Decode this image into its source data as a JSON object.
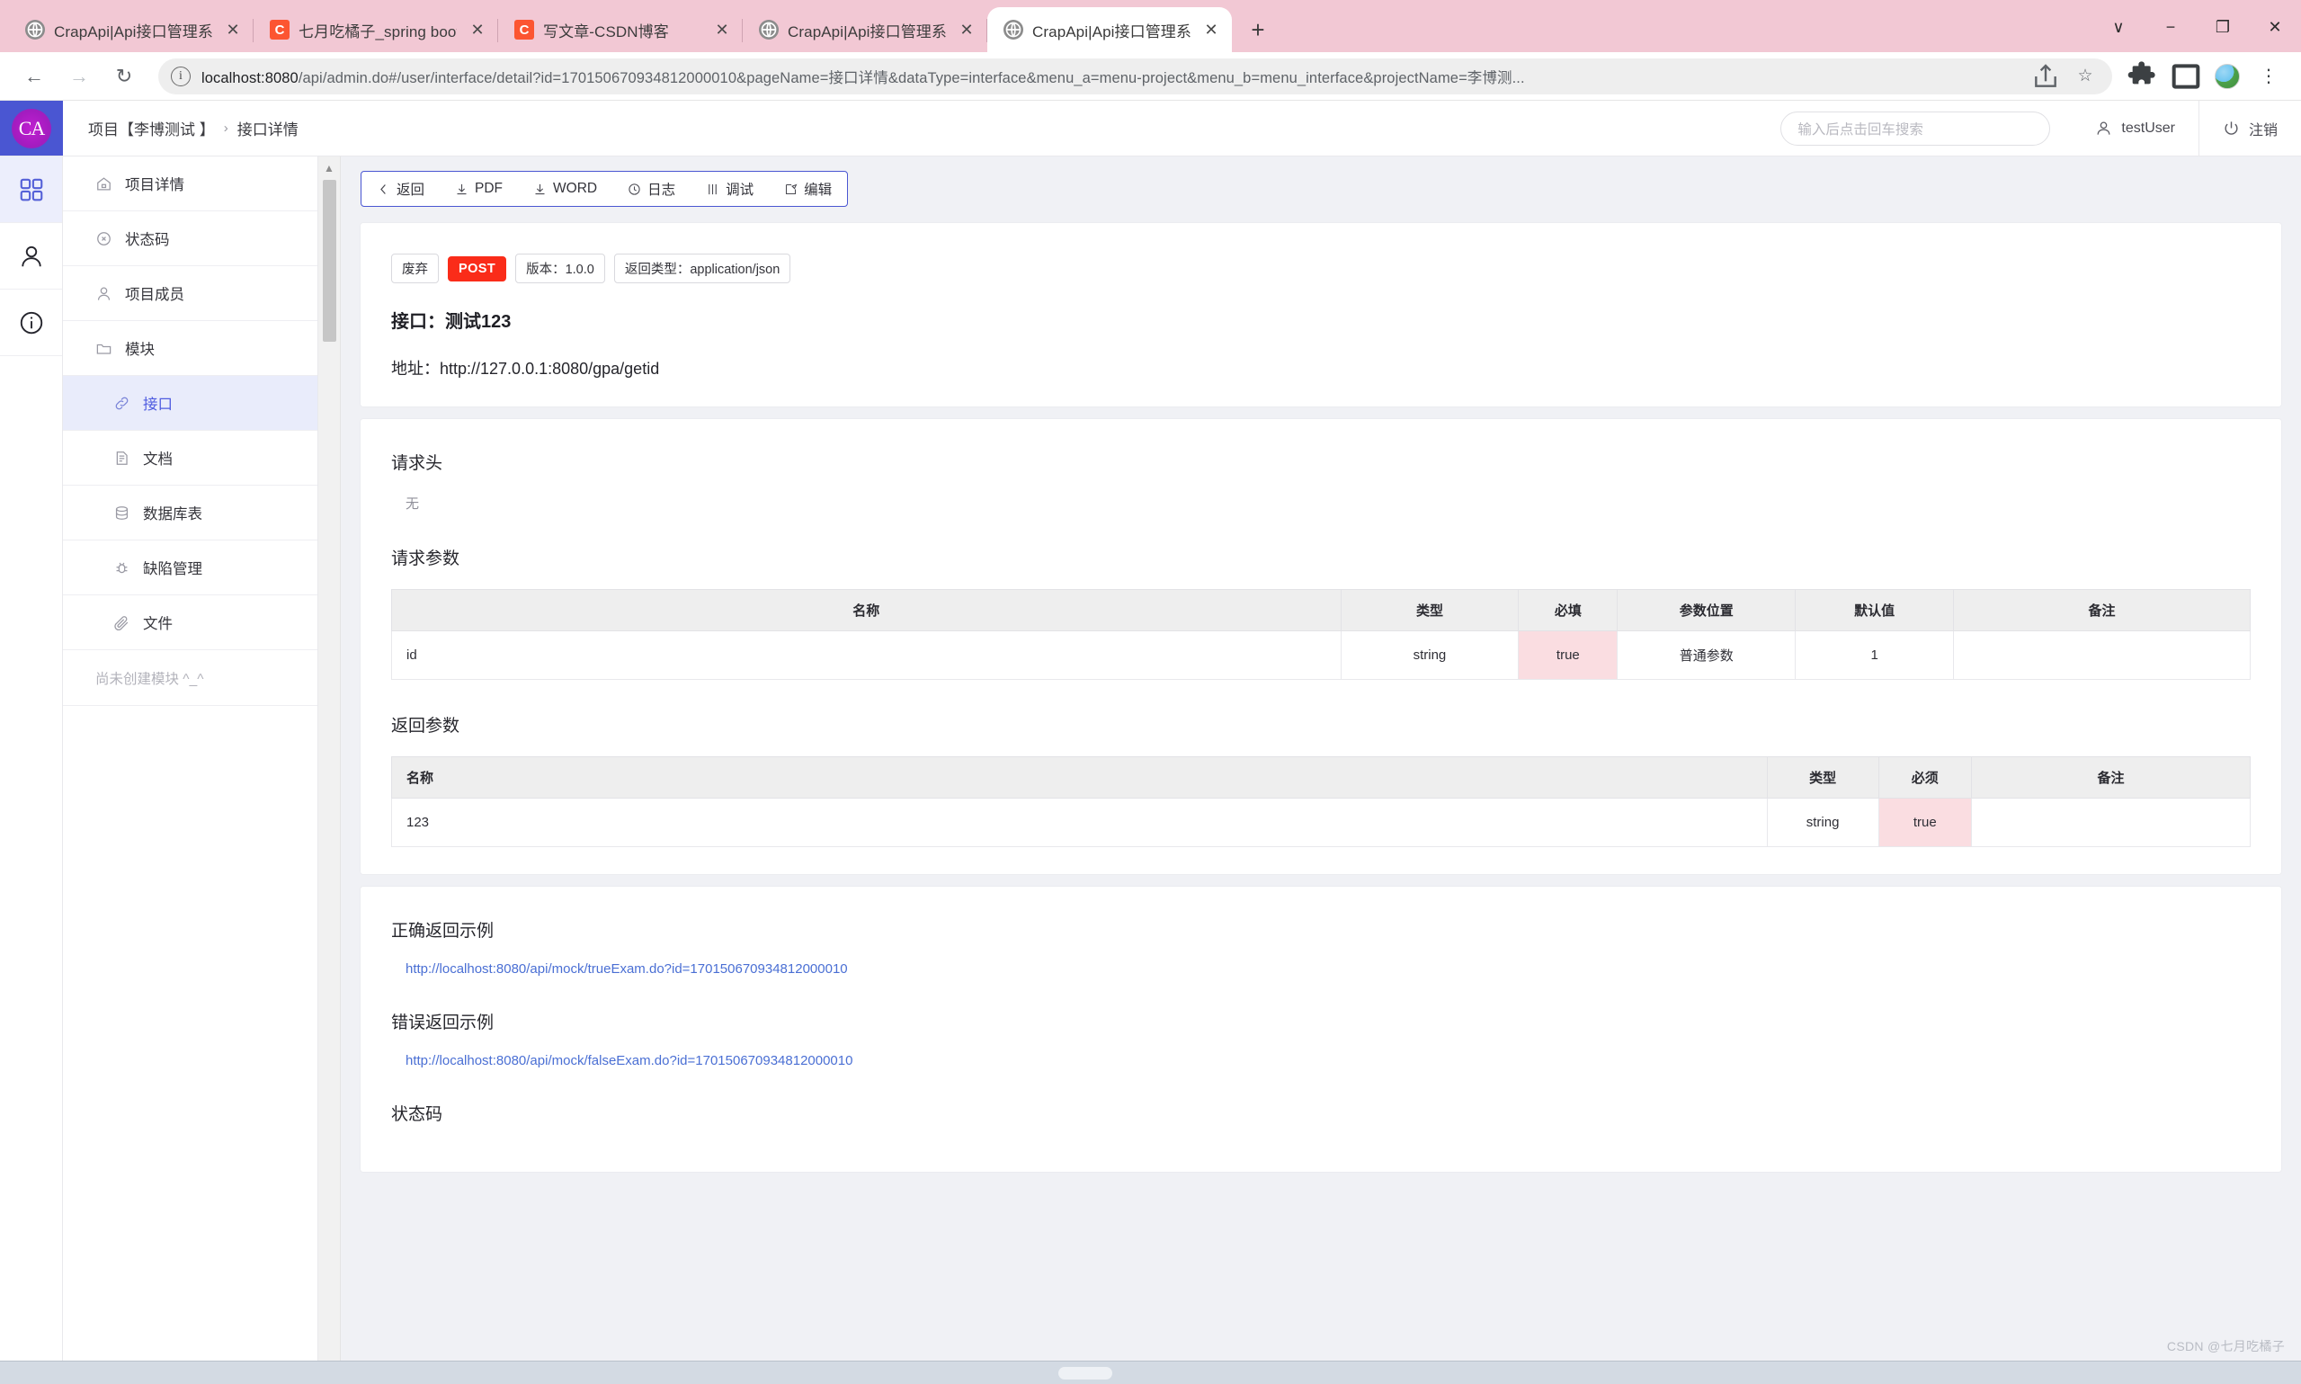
{
  "browser": {
    "tabs": [
      {
        "title": "CrapApi|Api接口管理系统",
        "favicon": "globe-icon",
        "active": false
      },
      {
        "title": "七月吃橘子_spring boot,java,jq",
        "favicon": "csdn-c-icon",
        "active": false
      },
      {
        "title": "写文章-CSDN博客",
        "favicon": "csdn-c-icon",
        "active": false
      },
      {
        "title": "CrapApi|Api接口管理系统",
        "favicon": "globe-icon",
        "active": false
      },
      {
        "title": "CrapApi|Api接口管理系统",
        "favicon": "globe-icon",
        "active": true
      }
    ],
    "new_tab_label": "+",
    "window_controls": {
      "minimize": "−",
      "maximize": "❐",
      "close": "✕",
      "list": "∨"
    },
    "nav": {
      "back": "←",
      "forward": "→",
      "reload": "↻"
    },
    "url_host": "localhost:8080",
    "url_rest": "/api/admin.do#/user/interface/detail?id=170150670934812000010&pageName=接口详情&dataType=interface&menu_a=menu-project&menu_b=menu_interface&projectName=李博测...",
    "omnibox_icons": [
      "share-icon",
      "bookmark-star-icon"
    ],
    "toolbar_icons": [
      "extensions-puzzle-icon",
      "sidepanel-icon",
      "profile-avatar-icon",
      "chrome-menu-icon"
    ]
  },
  "app": {
    "logo_text": "CA",
    "breadcrumb": {
      "project": "项目【李博测试 】",
      "sep": "›",
      "page": "接口详情"
    },
    "search_placeholder": "输入后点击回车搜索",
    "user": "testUser",
    "logout": "注销"
  },
  "rail": [
    {
      "name": "grid-icon",
      "active": true
    },
    {
      "name": "user-icon",
      "active": false
    },
    {
      "name": "info-icon",
      "active": false
    }
  ],
  "sidebar": {
    "items": [
      {
        "label": "项目详情",
        "icon": "home-icon",
        "active": false,
        "sub": false
      },
      {
        "label": "状态码",
        "icon": "status-circle-icon",
        "active": false,
        "sub": false
      },
      {
        "label": "项目成员",
        "icon": "member-icon",
        "active": false,
        "sub": false
      },
      {
        "label": "模块",
        "icon": "folder-icon",
        "active": false,
        "sub": false
      },
      {
        "label": "接口",
        "icon": "link-icon",
        "active": true,
        "sub": true
      },
      {
        "label": "文档",
        "icon": "doc-icon",
        "active": false,
        "sub": true
      },
      {
        "label": "数据库表",
        "icon": "database-icon",
        "active": false,
        "sub": true
      },
      {
        "label": "缺陷管理",
        "icon": "bug-icon",
        "active": false,
        "sub": true
      },
      {
        "label": "文件",
        "icon": "paperclip-icon",
        "active": false,
        "sub": true
      }
    ],
    "empty_text": "尚未创建模块 ^_^"
  },
  "toolbar": {
    "buttons": [
      {
        "label": "返回",
        "icon": "chevron-left-icon"
      },
      {
        "label": "PDF",
        "icon": "download-icon"
      },
      {
        "label": "WORD",
        "icon": "download-icon"
      },
      {
        "label": "日志",
        "icon": "clock-icon"
      },
      {
        "label": "调试",
        "icon": "sliders-icon"
      },
      {
        "label": "编辑",
        "icon": "edit-icon"
      }
    ]
  },
  "interface": {
    "tags": [
      {
        "text": "废弃",
        "type": "plain"
      },
      {
        "text": "POST",
        "type": "method"
      },
      {
        "text": "版本：1.0.0",
        "type": "plain"
      },
      {
        "text": "返回类型：application/json",
        "type": "plain"
      }
    ],
    "name_label": "接口：测试123",
    "url_label": "地址：http://127.0.0.1:8080/gpa/getid"
  },
  "request_header": {
    "title": "请求头",
    "empty": "无"
  },
  "request_params": {
    "title": "请求参数",
    "columns": [
      "名称",
      "类型",
      "必填",
      "参数位置",
      "默认值",
      "备注"
    ],
    "rows": [
      {
        "名称": "id",
        "类型": "string",
        "必填": "true",
        "参数位置": "普通参数",
        "默认值": "1",
        "备注": ""
      }
    ]
  },
  "response_params": {
    "title": "返回参数",
    "columns": [
      "名称",
      "类型",
      "必须",
      "备注"
    ],
    "rows": [
      {
        "名称": "123",
        "类型": "string",
        "必须": "true",
        "备注": ""
      }
    ]
  },
  "examples": {
    "success_title": "正确返回示例",
    "success_link": "http://localhost:8080/api/mock/trueExam.do?id=170150670934812000010",
    "error_title": "错误返回示例",
    "error_link": "http://localhost:8080/api/mock/falseExam.do?id=170150670934812000010",
    "status_title": "状态码"
  },
  "watermark": "CSDN @七月吃橘子"
}
